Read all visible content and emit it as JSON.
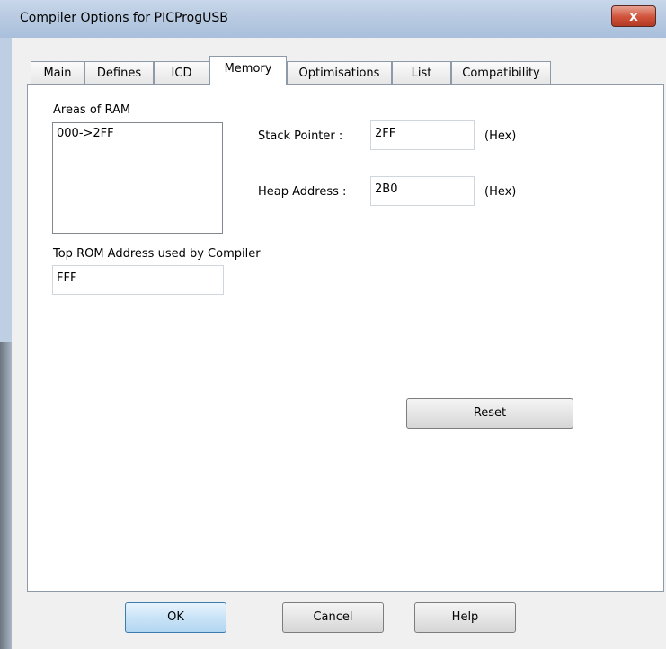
{
  "window": {
    "title": "Compiler Options for PICProgUSB",
    "close_symbol": "x"
  },
  "tabs": [
    {
      "label": "Main",
      "active": false
    },
    {
      "label": "Defines",
      "active": false
    },
    {
      "label": "ICD",
      "active": false
    },
    {
      "label": "Memory",
      "active": true
    },
    {
      "label": "Optimisations",
      "active": false
    },
    {
      "label": "List",
      "active": false
    },
    {
      "label": "Compatibility",
      "active": false
    }
  ],
  "memory": {
    "ram_areas_label": "Areas of RAM",
    "ram_areas": [
      "000->2FF"
    ],
    "stack_pointer_label": "Stack Pointer :",
    "stack_pointer_value": "2FF",
    "stack_pointer_unit": "(Hex)",
    "heap_address_label": "Heap Address :",
    "heap_address_value": "2B0",
    "heap_address_unit": "(Hex)",
    "top_rom_label": "Top ROM Address used by Compiler",
    "top_rom_value": "FFF",
    "reset_label": "Reset"
  },
  "footer": {
    "ok_label": "OK",
    "cancel_label": "Cancel",
    "help_label": "Help"
  }
}
